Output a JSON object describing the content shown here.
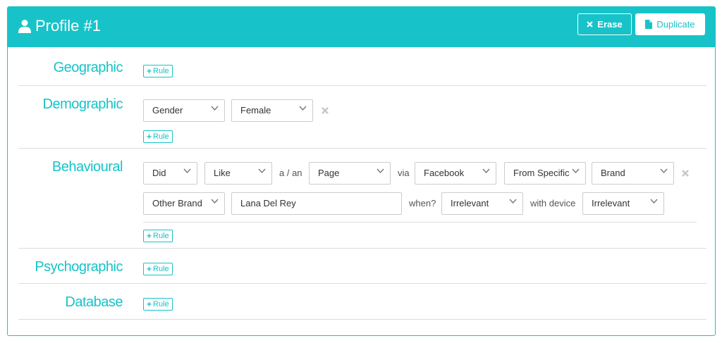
{
  "header": {
    "title": "Profile #1",
    "erase_label": "Erase",
    "duplicate_label": "Duplicate"
  },
  "colors": {
    "accent": "#17c3c8",
    "border": "#cccccc",
    "remove": "#c8c8c8"
  },
  "rule_label": "Rule",
  "sections": {
    "geographic": {
      "label": "Geographic"
    },
    "demographic": {
      "label": "Demographic",
      "selects": [
        "Gender",
        "Female"
      ]
    },
    "behavioural": {
      "label": "Behavioural",
      "row1": {
        "did": "Did",
        "like": "Like",
        "a_an": "a / an",
        "page": "Page",
        "via": "via",
        "facebook": "Facebook",
        "from_specific": "From Specific",
        "brand": "Brand"
      },
      "row2": {
        "other_brand": "Other Brand",
        "text_value": "Lana Del Rey",
        "when": "when?",
        "when_value": "Irrelevant",
        "with_device": "with device",
        "device_value": "Irrelevant"
      }
    },
    "psychographic": {
      "label": "Psychographic"
    },
    "database": {
      "label": "Database"
    }
  }
}
